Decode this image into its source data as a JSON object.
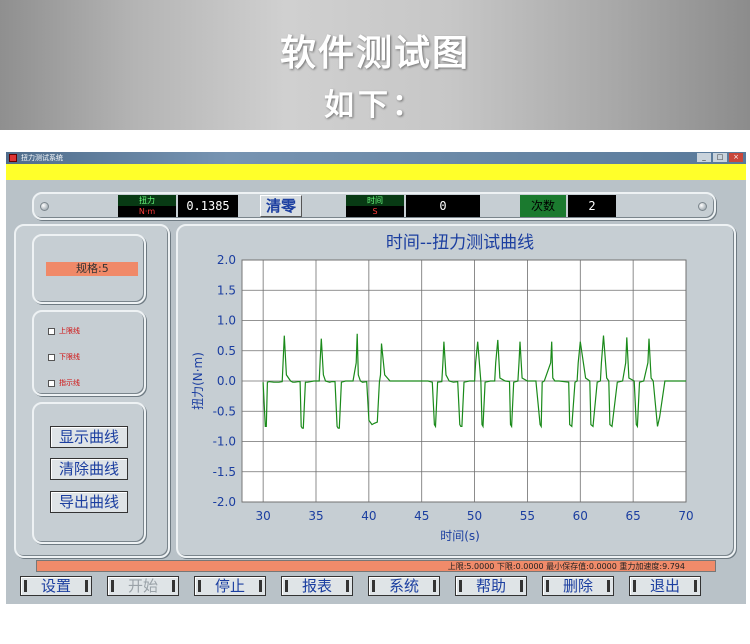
{
  "banner": {
    "title": "软件测试图",
    "subtitle": "如下："
  },
  "window": {
    "title": "扭力测试系统",
    "controls": [
      "_",
      "□",
      "×"
    ]
  },
  "readouts": {
    "torque": {
      "label": "扭力",
      "unit": "N·m",
      "value": "0.1385"
    },
    "zero_button": "清零",
    "time": {
      "label": "时间",
      "unit": "S",
      "value": "0"
    },
    "count": {
      "label": "次数",
      "value": "2"
    }
  },
  "left_panel": {
    "spec": "规格:5",
    "checkboxes": [
      "上限线",
      "下限线",
      "指示线"
    ],
    "buttons": [
      "显示曲线",
      "清除曲线",
      "导出曲线"
    ]
  },
  "status_bar": "上限:5.0000   下限:0.0000   最小保存值:0.0000   重力加速度:9.794",
  "bottom_buttons": [
    {
      "label": "设置",
      "enabled": true
    },
    {
      "label": "开始",
      "enabled": false
    },
    {
      "label": "停止",
      "enabled": true
    },
    {
      "label": "报表",
      "enabled": true
    },
    {
      "label": "系统",
      "enabled": true
    },
    {
      "label": "帮助",
      "enabled": true
    },
    {
      "label": "删除",
      "enabled": true
    },
    {
      "label": "退出",
      "enabled": true
    }
  ],
  "colors": {
    "series": "#1a8a1a",
    "plot_bg": "#ffffff",
    "title": "#1b3ea0",
    "status": "#f08b6a",
    "highlight": "#ffff2a"
  },
  "chart_data": {
    "type": "line",
    "title": "时间--扭力测试曲线",
    "xlabel": "时间(s)",
    "ylabel": "扭力(N·m)",
    "xlim": [
      28,
      70
    ],
    "ylim": [
      -2.0,
      2.0
    ],
    "xticks": [
      30,
      35,
      40,
      45,
      50,
      55,
      60,
      65,
      70
    ],
    "yticks": [
      -2.0,
      -1.5,
      -1.0,
      -0.5,
      0.0,
      0.5,
      1.0,
      1.5,
      2.0
    ],
    "grid": true,
    "series": [
      {
        "x": [
          30.0,
          30.2,
          30.3,
          30.4,
          30.6,
          31.0,
          31.5,
          31.8,
          31.9,
          32.0,
          32.2,
          32.6,
          32.8,
          33.0,
          33.3,
          33.5,
          33.6,
          33.7,
          33.8,
          34.0,
          34.2,
          34.8,
          35.3,
          35.4,
          35.5,
          35.7,
          35.9,
          36.3,
          36.5,
          36.8,
          37.0,
          37.1,
          37.2,
          37.4,
          37.8,
          38.5,
          38.8,
          38.9,
          39.0,
          39.2,
          39.4,
          39.8,
          40.0,
          40.3,
          40.5,
          40.8,
          41.0,
          41.1,
          41.2,
          41.5,
          42.0,
          42.5,
          42.9,
          43.0,
          43.2,
          43.6,
          44.0,
          44.7,
          45.0,
          45.6,
          46.0,
          46.2,
          46.3,
          46.5,
          46.9,
          47.0,
          47.1,
          47.3,
          47.6,
          48.0,
          48.4,
          48.6,
          48.7,
          48.8,
          49.0,
          49.5,
          50.0,
          50.1,
          50.3,
          50.6,
          50.7,
          50.8,
          51.0,
          51.5,
          51.9,
          52.0,
          52.2,
          52.4,
          52.9,
          53.3,
          53.4,
          53.5,
          53.7,
          54.1,
          54.2,
          54.3,
          54.5,
          55.0,
          55.8,
          56.2,
          56.3,
          56.4,
          56.6,
          57.2,
          57.3,
          57.4,
          57.6,
          58.0,
          58.9,
          59.0,
          59.2,
          59.5,
          59.7,
          59.8,
          60.0,
          60.5,
          60.9,
          61.0,
          61.2,
          61.6,
          61.9,
          62.0,
          62.2,
          62.5,
          62.7,
          62.8,
          63.0,
          63.5,
          64.0,
          64.3,
          64.4,
          64.6,
          65.1,
          65.3,
          65.4,
          65.6,
          66.0,
          66.4,
          66.5,
          66.7,
          66.9,
          67.3,
          67.5,
          68.0,
          70.0
        ],
        "y": [
          -0.02,
          -0.75,
          -0.75,
          -0.02,
          -0.01,
          -0.02,
          -0.02,
          -0.01,
          0.35,
          0.75,
          0.1,
          0.0,
          -0.02,
          -0.02,
          -0.01,
          -0.01,
          -0.75,
          -0.78,
          -0.78,
          -0.02,
          -0.02,
          0.0,
          0.0,
          0.35,
          0.7,
          0.1,
          0.0,
          -0.02,
          -0.01,
          -0.01,
          -0.75,
          -0.78,
          -0.78,
          -0.02,
          0.0,
          0.0,
          0.3,
          0.78,
          0.1,
          0.0,
          -0.02,
          -0.01,
          -0.65,
          -0.72,
          -0.7,
          -0.68,
          -0.02,
          0.1,
          0.62,
          0.1,
          0.0,
          0.0,
          0.0,
          0.0,
          0.0,
          0.0,
          0.0,
          0.0,
          0.0,
          0.0,
          -0.02,
          -0.72,
          -0.75,
          -0.02,
          -0.01,
          0.3,
          0.65,
          0.1,
          0.0,
          -0.02,
          -0.01,
          -0.72,
          -0.75,
          -0.75,
          -0.02,
          0.0,
          0.0,
          0.3,
          0.65,
          -0.02,
          -0.72,
          -0.75,
          -0.02,
          0.0,
          0.0,
          0.3,
          0.68,
          0.05,
          0.0,
          -0.01,
          -0.72,
          -0.75,
          -0.02,
          0.0,
          0.3,
          0.65,
          0.05,
          0.0,
          0.0,
          -0.72,
          -0.75,
          -0.02,
          0.0,
          0.3,
          0.65,
          0.05,
          0.0,
          0.0,
          -0.02,
          -0.72,
          -0.75,
          -0.02,
          0.0,
          0.3,
          0.65,
          0.05,
          0.0,
          -0.72,
          -0.75,
          -0.02,
          0.0,
          0.3,
          0.75,
          0.05,
          0.0,
          -0.72,
          -0.75,
          -0.02,
          0.0,
          0.3,
          0.72,
          0.05,
          0.0,
          -0.72,
          -0.75,
          -0.02,
          0.0,
          0.3,
          0.7,
          0.05,
          0.0,
          -0.75,
          -0.6,
          0.0,
          0.0
        ]
      }
    ]
  }
}
